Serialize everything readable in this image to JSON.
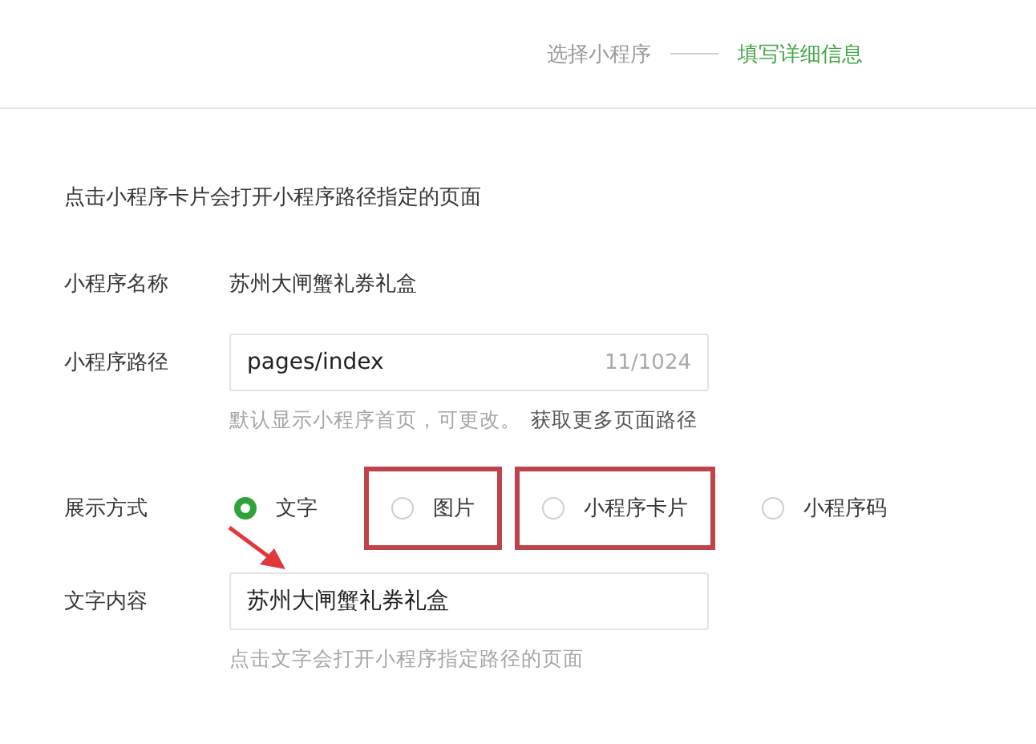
{
  "steps": [
    {
      "label": "选择小程序",
      "selected": false
    },
    {
      "label": "填写详细信息",
      "selected": true
    }
  ],
  "intro": "点击小程序卡片会打开小程序路径指定的页面",
  "name_row": {
    "label": "小程序名称",
    "value": "苏州大闸蟹礼券礼盒"
  },
  "path_row": {
    "label": "小程序路径",
    "value": "pages/index",
    "counter": "11/1024",
    "hint": "默认显示小程序首页，可更改。",
    "link": "获取更多页面路径"
  },
  "display_row": {
    "label": "展示方式",
    "options": [
      {
        "label": "文字",
        "selected": true,
        "highlighted": false
      },
      {
        "label": "图片",
        "selected": false,
        "highlighted": true
      },
      {
        "label": "小程序卡片",
        "selected": false,
        "highlighted": true
      },
      {
        "label": "小程序码",
        "selected": false,
        "highlighted": false
      }
    ]
  },
  "text_row": {
    "label": "文字内容",
    "value": "苏州大闸蟹礼券礼盒",
    "hint": "点击文字会打开小程序指定路径的页面"
  }
}
